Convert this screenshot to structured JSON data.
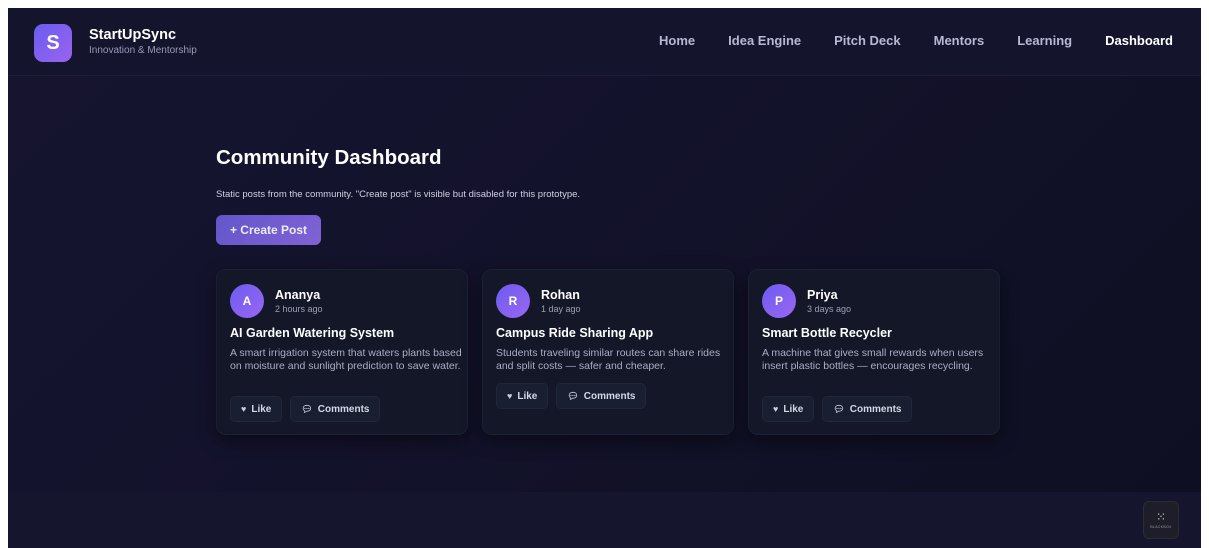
{
  "brand": {
    "logo_letter": "S",
    "name": "StartUpSync",
    "tagline": "Innovation & Mentorship"
  },
  "nav": {
    "items": [
      "Home",
      "Idea Engine",
      "Pitch Deck",
      "Mentors",
      "Learning",
      "Dashboard"
    ],
    "active": "Dashboard"
  },
  "page": {
    "title": "Community Dashboard",
    "subtitle": "Static posts from the community. \"Create post\" is visible but disabled for this prototype.",
    "create_label": "+ Create Post"
  },
  "actions": {
    "like_label": "Like",
    "comments_label": "Comments"
  },
  "posts": [
    {
      "initial": "A",
      "author": "Ananya",
      "time": "2 hours ago",
      "title": "AI Garden Watering System",
      "desc": "A smart irrigation system that waters plants based on moisture and sunlight prediction to save water."
    },
    {
      "initial": "R",
      "author": "Rohan",
      "time": "1 day ago",
      "title": "Campus Ride Sharing App",
      "desc": "Students traveling similar routes can share rides and split costs — safer and cheaper."
    },
    {
      "initial": "P",
      "author": "Priya",
      "time": "3 days ago",
      "title": "Smart Bottle Recycler",
      "desc": "A machine that gives small rewards when users insert plastic bottles — encourages recycling."
    }
  ],
  "corner_badge": {
    "label": "BLACKBOX",
    "icon": "grid-dots-icon"
  },
  "colors": {
    "accent": "#7b60e6",
    "background": "#13122b",
    "card": "#141728"
  }
}
